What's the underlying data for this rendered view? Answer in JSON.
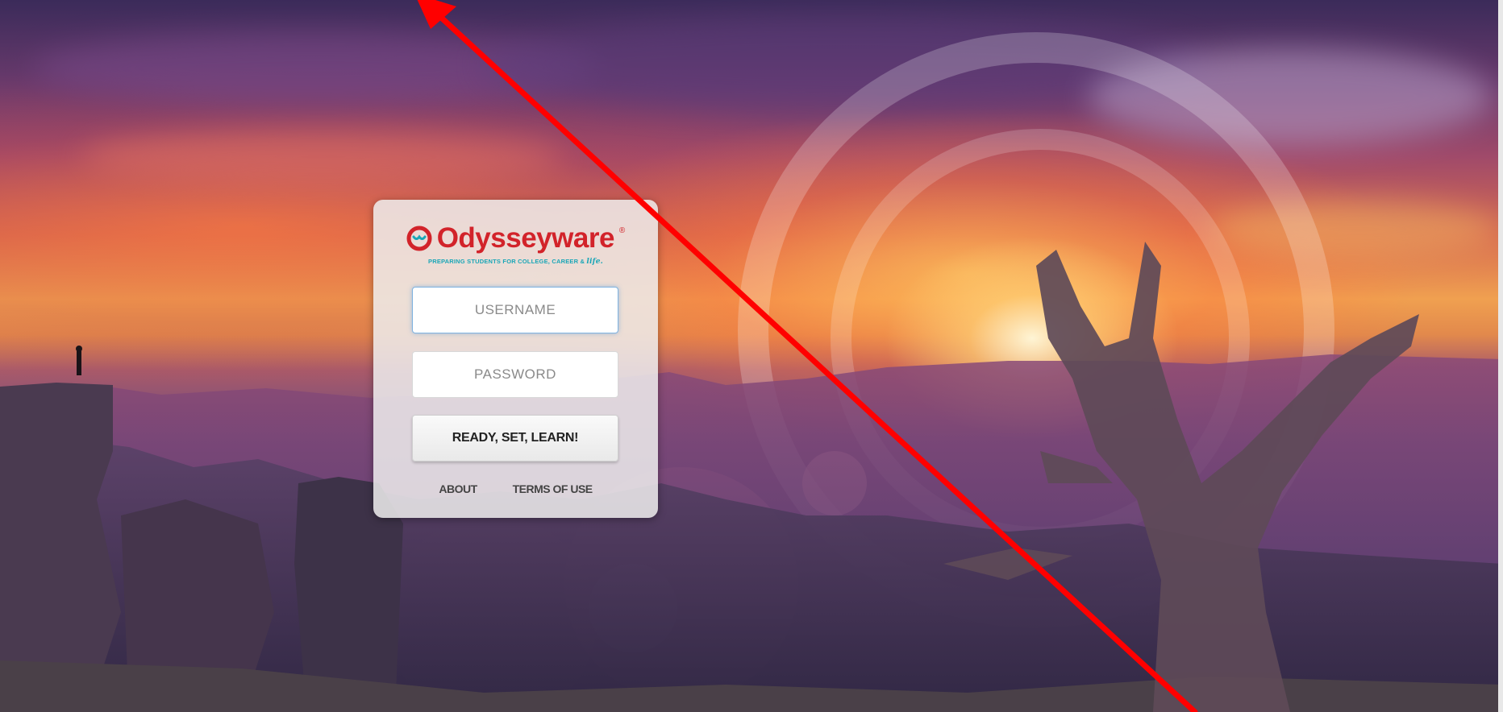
{
  "login": {
    "brand_name": "Odysseyware",
    "brand_mark": "®",
    "tagline_prefix": "PREPARING STUDENTS FOR COLLEGE, CAREER & ",
    "tagline_life": "life.",
    "username_placeholder": "USERNAME",
    "password_placeholder": "PASSWORD",
    "submit_label": "READY, SET, LEARN!",
    "about_label": "ABOUT",
    "terms_label": "TERMS OF USE"
  },
  "colors": {
    "brand_red": "#d2232a",
    "tagline_teal": "#1aa6b7",
    "annotation_arrow": "#ff0000"
  },
  "icons": {
    "logo": "odysseyware-logo-icon"
  }
}
